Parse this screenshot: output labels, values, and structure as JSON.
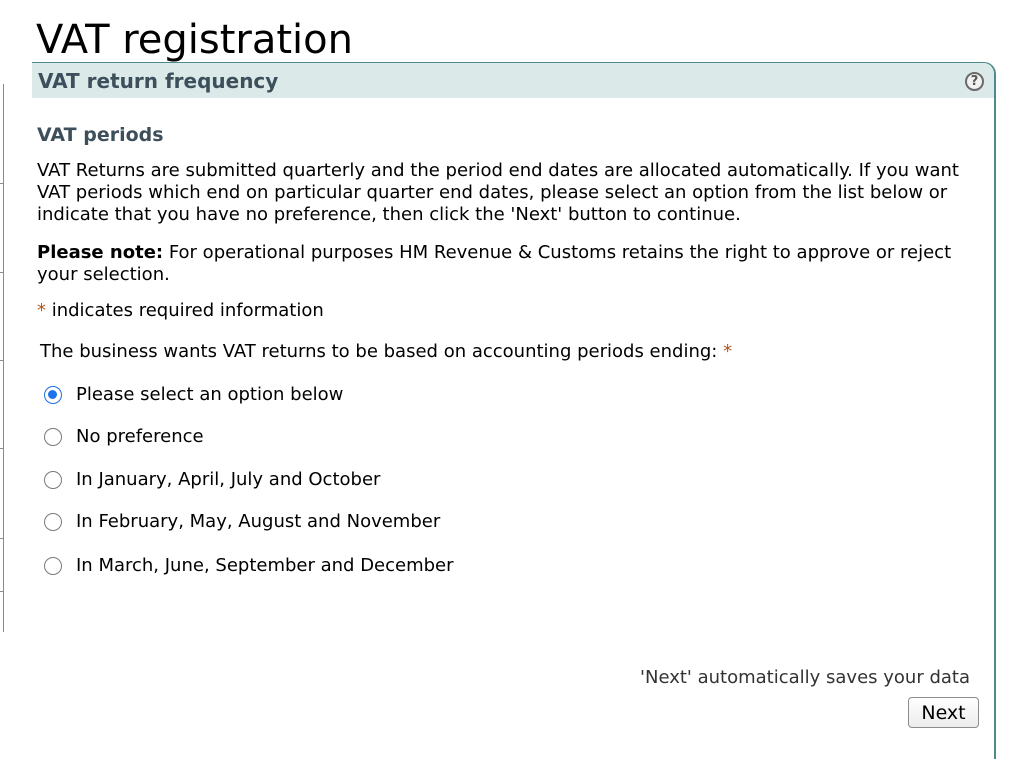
{
  "page": {
    "title": "VAT registration"
  },
  "panel": {
    "title": "VAT return frequency",
    "help_icon": "question-mark-icon"
  },
  "section": {
    "title": "VAT periods",
    "intro": "VAT Returns are submitted quarterly and the period end dates are allocated automatically. If you want VAT periods which end on particular quarter end dates, please select an option from the list below or indicate that you have no preference, then click the 'Next' button to continue.",
    "note_label": "Please note:",
    "note_text": " For operational purposes HM Revenue & Customs retains the right to approve or reject your selection.",
    "required_marker": "*",
    "required_text": " indicates required information",
    "question": "The business wants VAT returns to be based on accounting periods ending: "
  },
  "options": [
    {
      "label": "Please select an option below",
      "checked": true
    },
    {
      "label": "No preference",
      "checked": false
    },
    {
      "label": "In January, April, July and October",
      "checked": false
    },
    {
      "label": "In February, May, August and November",
      "checked": false
    },
    {
      "label": "In March, June, September and December",
      "checked": false
    }
  ],
  "footer": {
    "save_note": "'Next' automatically saves your data",
    "next_label": "Next"
  },
  "colors": {
    "panel_border": "#4e8a8c",
    "header_bg": "#dbe9e9",
    "heading_text": "#3d4f5a",
    "required": "#b0541a",
    "radio_selected": "#1f73ea"
  }
}
